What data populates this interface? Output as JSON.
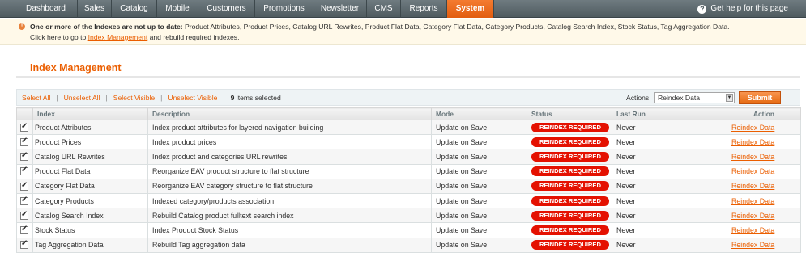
{
  "nav": {
    "items": [
      {
        "label": "Dashboard"
      },
      {
        "label": "Sales"
      },
      {
        "label": "Catalog"
      },
      {
        "label": "Mobile"
      },
      {
        "label": "Customers"
      },
      {
        "label": "Promotions"
      },
      {
        "label": "Newsletter"
      },
      {
        "label": "CMS"
      },
      {
        "label": "Reports"
      },
      {
        "label": "System"
      }
    ],
    "active": "System",
    "help_label": "Get help for this page"
  },
  "message": {
    "bold": "One or more of the Indexes are not up to date:",
    "indexes": "Product Attributes, Product Prices, Catalog URL Rewrites, Product Flat Data, Category Flat Data, Category Products, Catalog Search Index, Stock Status, Tag Aggregation Data.",
    "prefix": "Click here to go to",
    "link": "Index Management",
    "suffix": "and rebuild required indexes."
  },
  "page": {
    "title": "Index Management"
  },
  "massaction": {
    "select_all": "Select All",
    "unselect_all": "Unselect All",
    "select_visible": "Select Visible",
    "unselect_visible": "Unselect Visible",
    "selected_count": "9",
    "selected_suffix": "items selected",
    "actions_label": "Actions",
    "action_value": "Reindex Data",
    "submit_label": "Submit"
  },
  "grid": {
    "columns": [
      "Index",
      "Description",
      "Mode",
      "Status",
      "Last Run",
      "Action"
    ],
    "rows": [
      {
        "index": "Product Attributes",
        "description": "Index product attributes for layered navigation building",
        "mode": "Update on Save",
        "status": "REINDEX REQUIRED",
        "last_run": "Never",
        "action": "Reindex Data"
      },
      {
        "index": "Product Prices",
        "description": "Index product prices",
        "mode": "Update on Save",
        "status": "REINDEX REQUIRED",
        "last_run": "Never",
        "action": "Reindex Data"
      },
      {
        "index": "Catalog URL Rewrites",
        "description": "Index product and categories URL rewrites",
        "mode": "Update on Save",
        "status": "REINDEX REQUIRED",
        "last_run": "Never",
        "action": "Reindex Data"
      },
      {
        "index": "Product Flat Data",
        "description": "Reorganize EAV product structure to flat structure",
        "mode": "Update on Save",
        "status": "REINDEX REQUIRED",
        "last_run": "Never",
        "action": "Reindex Data"
      },
      {
        "index": "Category Flat Data",
        "description": "Reorganize EAV category structure to flat structure",
        "mode": "Update on Save",
        "status": "REINDEX REQUIRED",
        "last_run": "Never",
        "action": "Reindex Data"
      },
      {
        "index": "Category Products",
        "description": "Indexed category/products association",
        "mode": "Update on Save",
        "status": "REINDEX REQUIRED",
        "last_run": "Never",
        "action": "Reindex Data"
      },
      {
        "index": "Catalog Search Index",
        "description": "Rebuild Catalog product fulltext search index",
        "mode": "Update on Save",
        "status": "REINDEX REQUIRED",
        "last_run": "Never",
        "action": "Reindex Data"
      },
      {
        "index": "Stock Status",
        "description": "Index Product Stock Status",
        "mode": "Update on Save",
        "status": "REINDEX REQUIRED",
        "last_run": "Never",
        "action": "Reindex Data"
      },
      {
        "index": "Tag Aggregation Data",
        "description": "Rebuild Tag aggregation data",
        "mode": "Update on Save",
        "status": "REINDEX REQUIRED",
        "last_run": "Never",
        "action": "Reindex Data"
      }
    ]
  },
  "colors": {
    "accent": "#eb5e00",
    "nav_bg": "#5f6b70",
    "status_red": "#e41101",
    "message_bg": "#fff9e9"
  },
  "icons": {
    "help": "help-circle-icon",
    "message": "warning-icon",
    "checkbox": "checkmark-icon",
    "select": "dropdown-arrow-icon"
  }
}
